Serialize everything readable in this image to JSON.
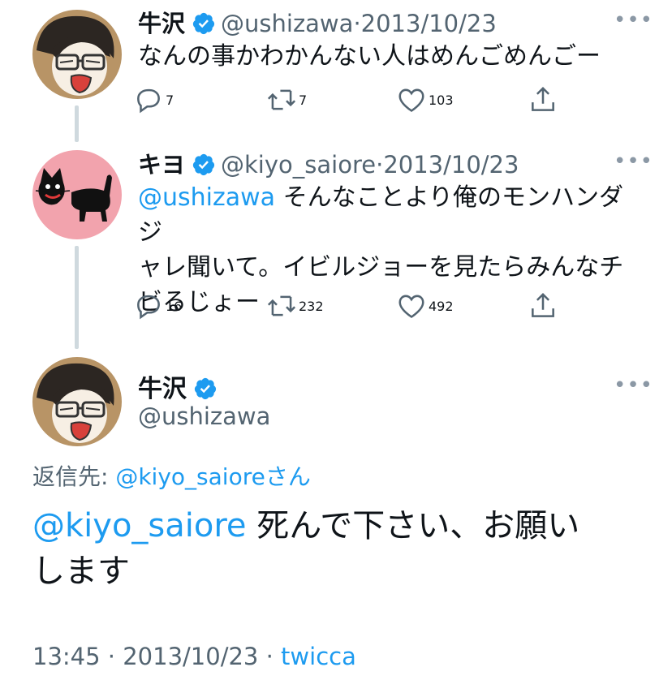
{
  "tweets": [
    {
      "name": "牛沢",
      "handle": "@ushizawa",
      "date": "2013/10/23",
      "text": "なんの事かわかんない人はめんごめんごー",
      "replies": "7",
      "retweets": "7",
      "likes": "103"
    },
    {
      "name": "キヨ",
      "handle": "@kiyo_saiore",
      "date": "2013/10/23",
      "mention": "@ushizawa",
      "text_line1": "そんなことより俺のモンハンダジ",
      "text_line2": "ャレ聞いて。イビルジョーを見たらみんなチ",
      "text_line3": "ビるじょー",
      "replies": "16",
      "retweets": "232",
      "likes": "492"
    }
  ],
  "main": {
    "name": "牛沢",
    "handle": "@ushizawa",
    "reply_prefix": "返信先: ",
    "reply_target": "@kiyo_saiore",
    "reply_suffix": "さん",
    "mention": "@kiyo_saiore",
    "text_line1": "死んで下さい、お願い",
    "text_line2": "します",
    "time": "13:45",
    "date": "2013/10/23",
    "client": "twicca"
  },
  "colors": {
    "accent": "#1d9bf0",
    "secondary_text": "#536471",
    "thread_line": "#cfd9de"
  },
  "icons": {
    "separator": "·",
    "more": "•••",
    "verified": "verified-badge-icon",
    "reply": "reply-icon",
    "retweet": "retweet-icon",
    "like": "heart-icon",
    "share": "share-icon"
  }
}
